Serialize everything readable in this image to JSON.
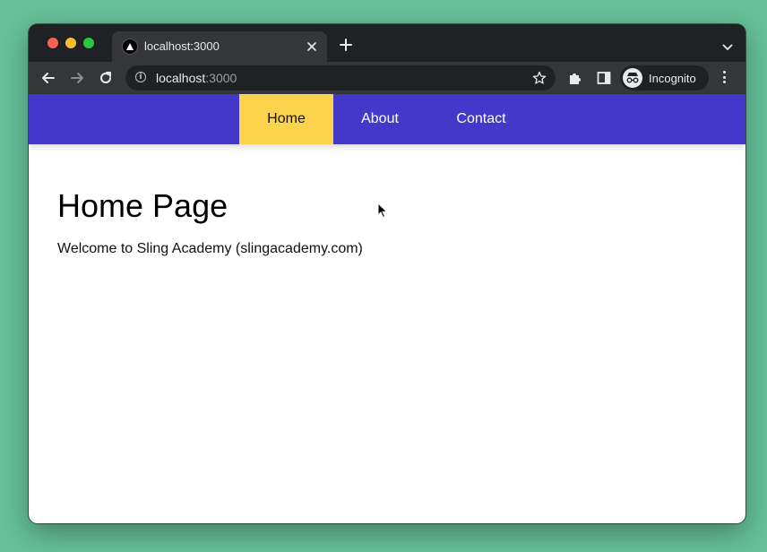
{
  "browser": {
    "tab": {
      "title": "localhost:3000"
    },
    "address_bar": {
      "host": "localhost",
      "port": ":3000"
    },
    "profile": {
      "label": "Incognito"
    }
  },
  "colors": {
    "navbar_bg": "#4338ca",
    "active_nav_bg": "#fcd34d",
    "desktop_bg": "#66c09a"
  },
  "nav": {
    "items": [
      {
        "label": "Home",
        "active": true
      },
      {
        "label": "About",
        "active": false
      },
      {
        "label": "Contact",
        "active": false
      }
    ]
  },
  "main": {
    "heading": "Home Page",
    "text": "Welcome to Sling Academy (slingacademy.com)"
  },
  "icons": [
    "back-arrow-icon",
    "forward-arrow-icon",
    "reload-icon",
    "info-icon",
    "star-icon",
    "extensions-icon",
    "side-panel-icon",
    "incognito-icon",
    "more-menu-icon",
    "close-icon",
    "plus-icon",
    "chevron-down-icon",
    "nextjs-favicon-icon",
    "mouse-cursor-icon"
  ]
}
